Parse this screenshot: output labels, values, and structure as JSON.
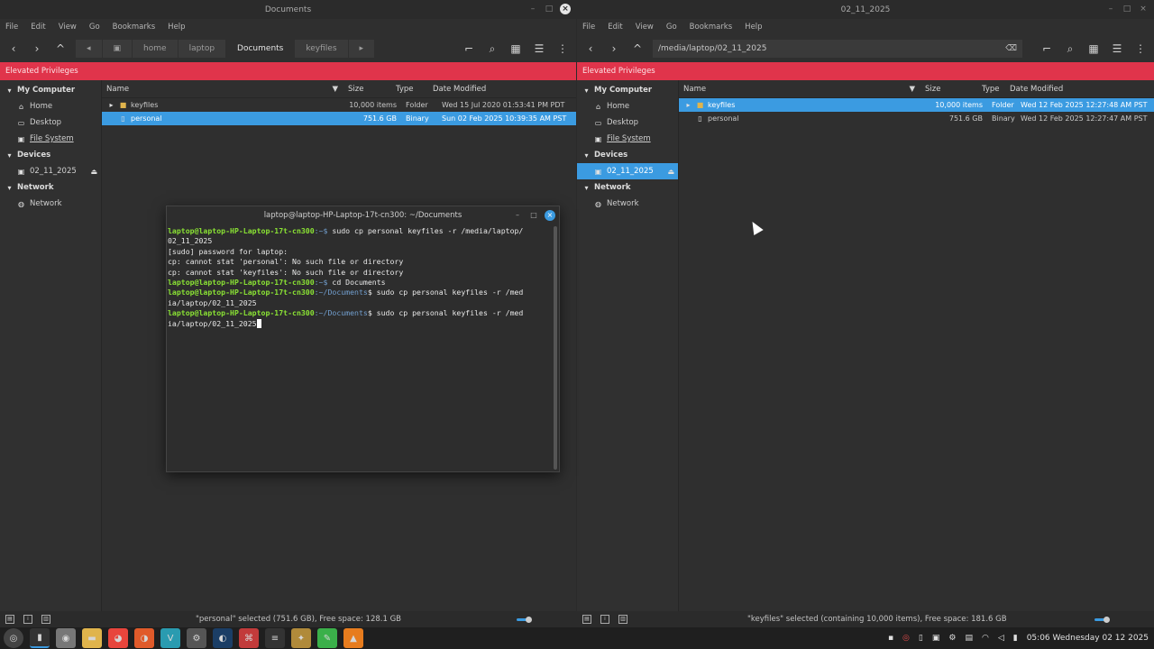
{
  "left_window": {
    "title": "Documents",
    "menu": [
      "File",
      "Edit",
      "View",
      "Go",
      "Bookmarks",
      "Help"
    ],
    "crumbs": [
      "home",
      "laptop",
      "Documents",
      "keyfiles"
    ],
    "elevated": "Elevated Privileges",
    "sidebar": {
      "my_computer": "My Computer",
      "home": "Home",
      "desktop": "Desktop",
      "filesystem": "File System",
      "devices": "Devices",
      "device1": "02_11_2025",
      "network_head": "Network",
      "network": "Network"
    },
    "columns": {
      "name": "Name",
      "size": "Size",
      "type": "Type",
      "date": "Date Modified"
    },
    "rows": [
      {
        "name": "keyfiles",
        "size": "10,000 items",
        "type": "Folder",
        "date": "Wed 15 Jul 2020 01:53:41 PM PDT"
      },
      {
        "name": "personal",
        "size": "751.6 GB",
        "type": "Binary",
        "date": "Sun 02 Feb 2025 10:39:35 AM PST"
      }
    ],
    "status": "\"personal\" selected (751.6 GB), Free space: 128.1 GB"
  },
  "right_window": {
    "title": "02_11_2025",
    "menu": [
      "File",
      "Edit",
      "View",
      "Go",
      "Bookmarks",
      "Help"
    ],
    "location": "/media/laptop/02_11_2025",
    "elevated": "Elevated Privileges",
    "sidebar": {
      "my_computer": "My Computer",
      "home": "Home",
      "desktop": "Desktop",
      "filesystem": "File System",
      "devices": "Devices",
      "device1": "02_11_2025",
      "network_head": "Network",
      "network": "Network"
    },
    "columns": {
      "name": "Name",
      "size": "Size",
      "type": "Type",
      "date": "Date Modified"
    },
    "rows": [
      {
        "name": "keyfiles",
        "size": "10,000 items",
        "type": "Folder",
        "date": "Wed 12 Feb 2025 12:27:48 AM PST"
      },
      {
        "name": "personal",
        "size": "751.6 GB",
        "type": "Binary",
        "date": "Wed 12 Feb 2025 12:27:47 AM PST"
      }
    ],
    "status": "\"keyfiles\" selected (containing 10,000 items), Free space: 181.6 GB"
  },
  "terminal": {
    "title": "laptop@laptop-HP-Laptop-17t-cn300: ~/Documents",
    "prompt_user": "laptop@laptop-HP-Laptop-17t-cn300",
    "lines": {
      "l1_path": ":~$",
      "l1_cmd": " sudo cp personal keyfiles -r /media/laptop/",
      "l2": "02_11_2025",
      "l3": "[sudo] password for laptop:",
      "l4": "cp: cannot stat 'personal': No such file or directory",
      "l5": "cp: cannot stat 'keyfiles': No such file or directory",
      "l6_path": ":~$",
      "l6_cmd": " cd Documents",
      "l7_path": ":~/Documents",
      "l7_cmd": "$ sudo cp personal keyfiles -r /med",
      "l8": "ia/laptop/02_11_2025",
      "l9_path": ":~/Documents",
      "l9_cmd": "$ sudo cp personal keyfiles -r /med",
      "l10": "ia/laptop/02_11_2025"
    }
  },
  "taskbar": {
    "clock": "05:06 Wednesday 02 12 2025"
  }
}
